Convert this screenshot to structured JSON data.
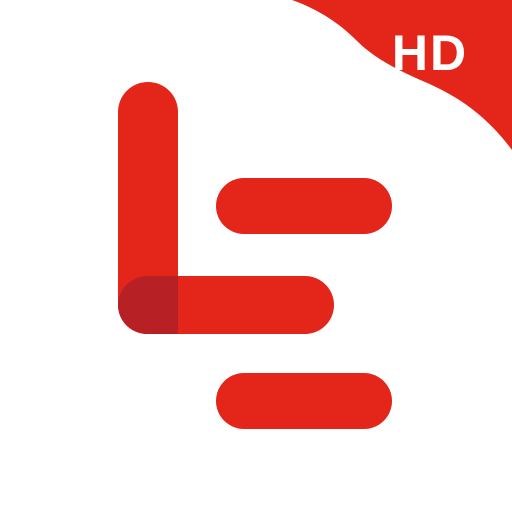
{
  "icon": {
    "badge_text": "HD",
    "colors": {
      "background": "#ffffff",
      "brand_red": "#e3251a",
      "overlap_dark_red": "#b72025",
      "badge_text": "#ffffff"
    },
    "logo": "letv-le-logo-icon"
  }
}
